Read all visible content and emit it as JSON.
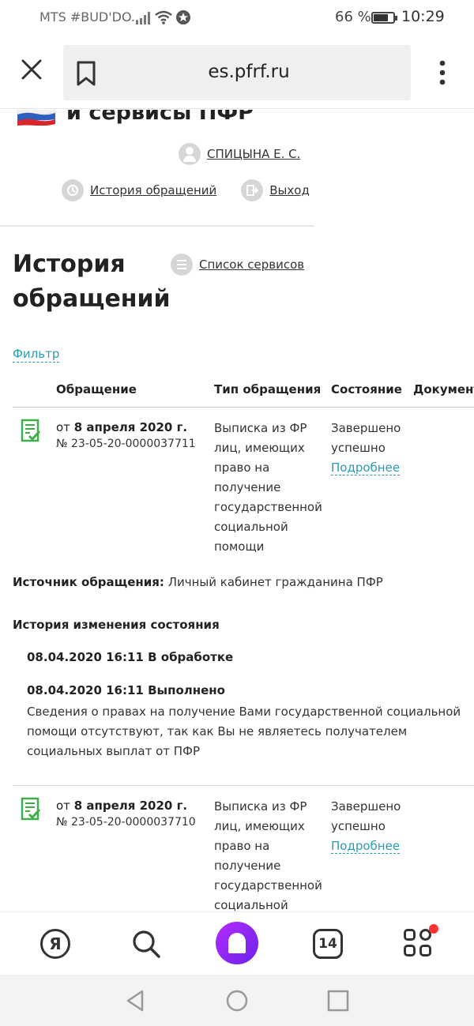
{
  "status_bar": {
    "carrier": "MTS #BUD'DO...",
    "battery": "66 %",
    "time": "10:29"
  },
  "browser": {
    "url": "es.pfrf.ru"
  },
  "header": {
    "title_fragment": "и сервисы ПФР",
    "user_name": "СПИЦЫНА Е. С.",
    "history_link": "История обращений",
    "logout_link": "Выход"
  },
  "main": {
    "title": "История обращений",
    "services_link": "Список сервисов",
    "filter_link": "Фильтр"
  },
  "table": {
    "columns": [
      "Обращение",
      "Тип обращения",
      "Состояние",
      "Документ"
    ]
  },
  "records": [
    {
      "date_prefix": "от",
      "date": "8 апреля 2020 г.",
      "number": "№ 23-05-20-0000037711",
      "type": "Выписка из ФР лиц, имеющих право на получение государственной социальной помощи",
      "status": "Завершено успешно",
      "more": "Подробнее"
    },
    {
      "date_prefix": "от",
      "date": "8 апреля 2020 г.",
      "number": "№ 23-05-20-0000037710",
      "type": "Выписка из ФР лиц, имеющих право на получение государственной социальной",
      "status": "Завершено успешно",
      "more": "Подробнее"
    }
  ],
  "details": {
    "source_label": "Источник обращения:",
    "source_value": "Личный кабинет гражданина ПФР",
    "history_title": "История изменения состояния",
    "history": [
      {
        "datetime": "08.04.2020 16:11",
        "state": "В обработке"
      },
      {
        "datetime": "08.04.2020 16:11",
        "state": "Выполнено"
      }
    ],
    "result_text": "Сведения о правах на получение Вами государственной социальной помощи отсутствуют, так как Вы не являетесь получателем социальных выплат от ПФР"
  },
  "bottom_bar": {
    "yandex_letter": "Я",
    "tabs_count": "14"
  },
  "icons": {
    "close": "close-icon",
    "bookmark": "bookmark-icon",
    "menu": "more-vertical-icon",
    "document": "document-check-icon"
  },
  "colors": {
    "link": "#2a9bb5",
    "doc_icon": "#3db04a",
    "alice": "#8a25f0",
    "badge": "#ff3333"
  }
}
